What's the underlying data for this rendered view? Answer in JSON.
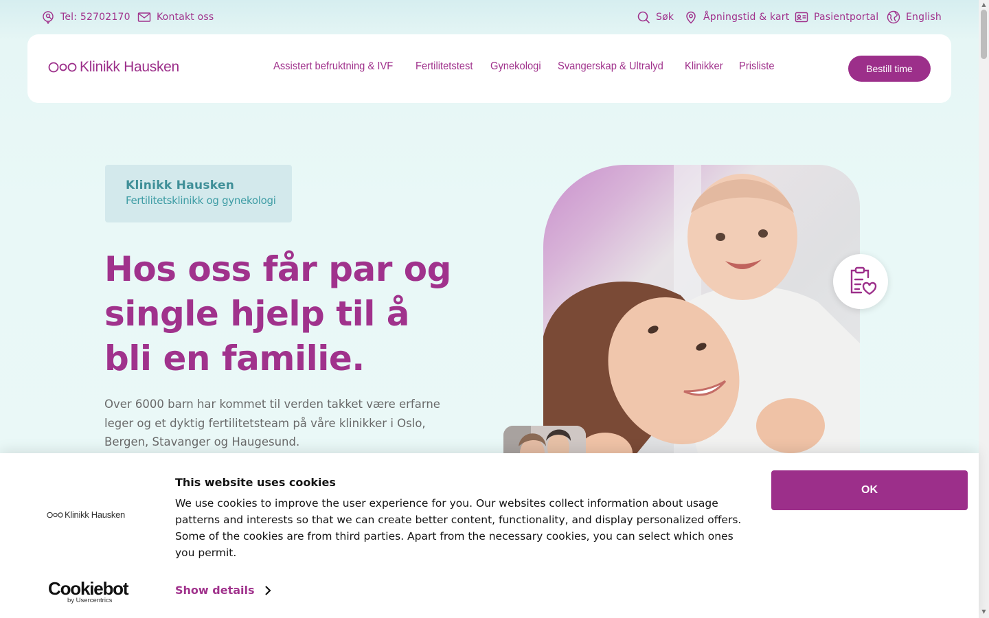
{
  "topbar": {
    "phone": "Tel: 52702170",
    "contact": "Kontakt oss",
    "search": "Søk",
    "hours": "Åpningstid & kart",
    "portal": "Pasientportal",
    "language": "English"
  },
  "header": {
    "logo_text": "Klinikk Hausken",
    "nav": [
      "Assistert befruktning & IVF",
      "Fertilitetstest",
      "Gynekologi",
      "Svangerskap & Ultralyd",
      "Klinikker",
      "Prisliste"
    ],
    "cta": "Bestill time"
  },
  "hero": {
    "badge_title": "Klinikk Hausken",
    "badge_subtitle": "Fertilitetsklinikk og gynekologi",
    "headline": "Hos oss får par og single hjelp til å bli en familie.",
    "text": "Over 6000 barn har kommet til verden takket være erfarne leger og et dyktig fertilitetsteam på våre klinikker i Oslo, Bergen, Stavanger og Haugesund."
  },
  "cookie": {
    "logo_text": "Klinikk Hausken",
    "title": "This website uses cookies",
    "body": "We use cookies to improve the user experience for you. Our websites collect information about usage patterns and interests so that we can create better content, functionality, and display personalized offers. Some of the cookies are from third parties. Apart from the necessary cookies, you can select which ones you permit.",
    "show_details": "Show details",
    "ok": "OK",
    "provider_name": "Cookiebot",
    "provider_sub": "by Usercentrics"
  },
  "colors": {
    "brand": "#9c2f8a",
    "background": "#e9f8f7",
    "badge": "#d3e9ec"
  }
}
